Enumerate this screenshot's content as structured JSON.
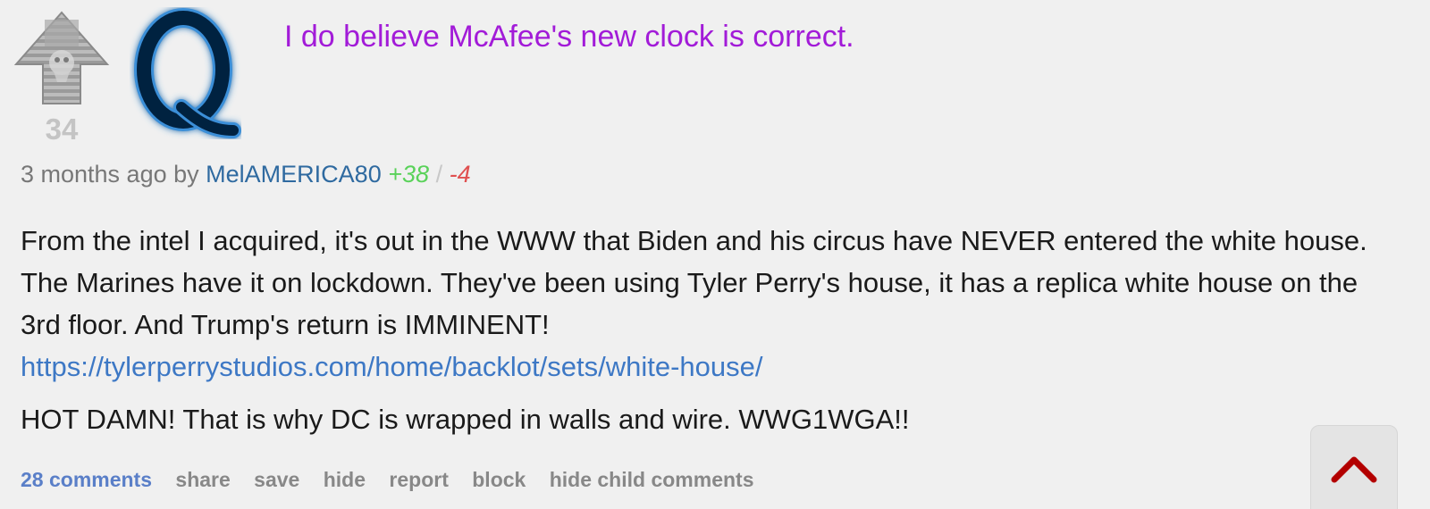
{
  "post": {
    "score": "34",
    "title": "I do believe McAfee's new clock is correct.",
    "meta": {
      "time": "3 months ago by",
      "author": "MelAMERICA80",
      "upvotes": "+38",
      "separator": "/",
      "downvotes": "-4"
    },
    "body": {
      "paragraph1": "From the intel I acquired, it's out in the WWW that Biden and his circus have NEVER entered the white house. The Marines have it on lockdown. They've been using Tyler Perry's house, it has a replica white house on the 3rd floor. And Trump's return is IMMINENT!",
      "link": "https://tylerperrystudios.com/home/backlot/sets/white-house/",
      "paragraph2": "HOT DAMN! That is why DC is wrapped in walls and wire. WWG1WGA!!"
    },
    "actions": {
      "comments": "28 comments",
      "share": "share",
      "save": "save",
      "hide": "hide",
      "report": "report",
      "block": "block",
      "hide_children": "hide child comments"
    }
  },
  "icons": {
    "upvote": "upvote-arrow-icon",
    "avatar": "q-avatar-icon",
    "scroll_top": "chevron-up-icon"
  },
  "colors": {
    "title": "#a21bd8",
    "author": "#2f6aa0",
    "upvotes": "#5ad25a",
    "downvotes": "#e05050",
    "link": "#3d78c5",
    "scroll_chevron": "#b30000"
  }
}
